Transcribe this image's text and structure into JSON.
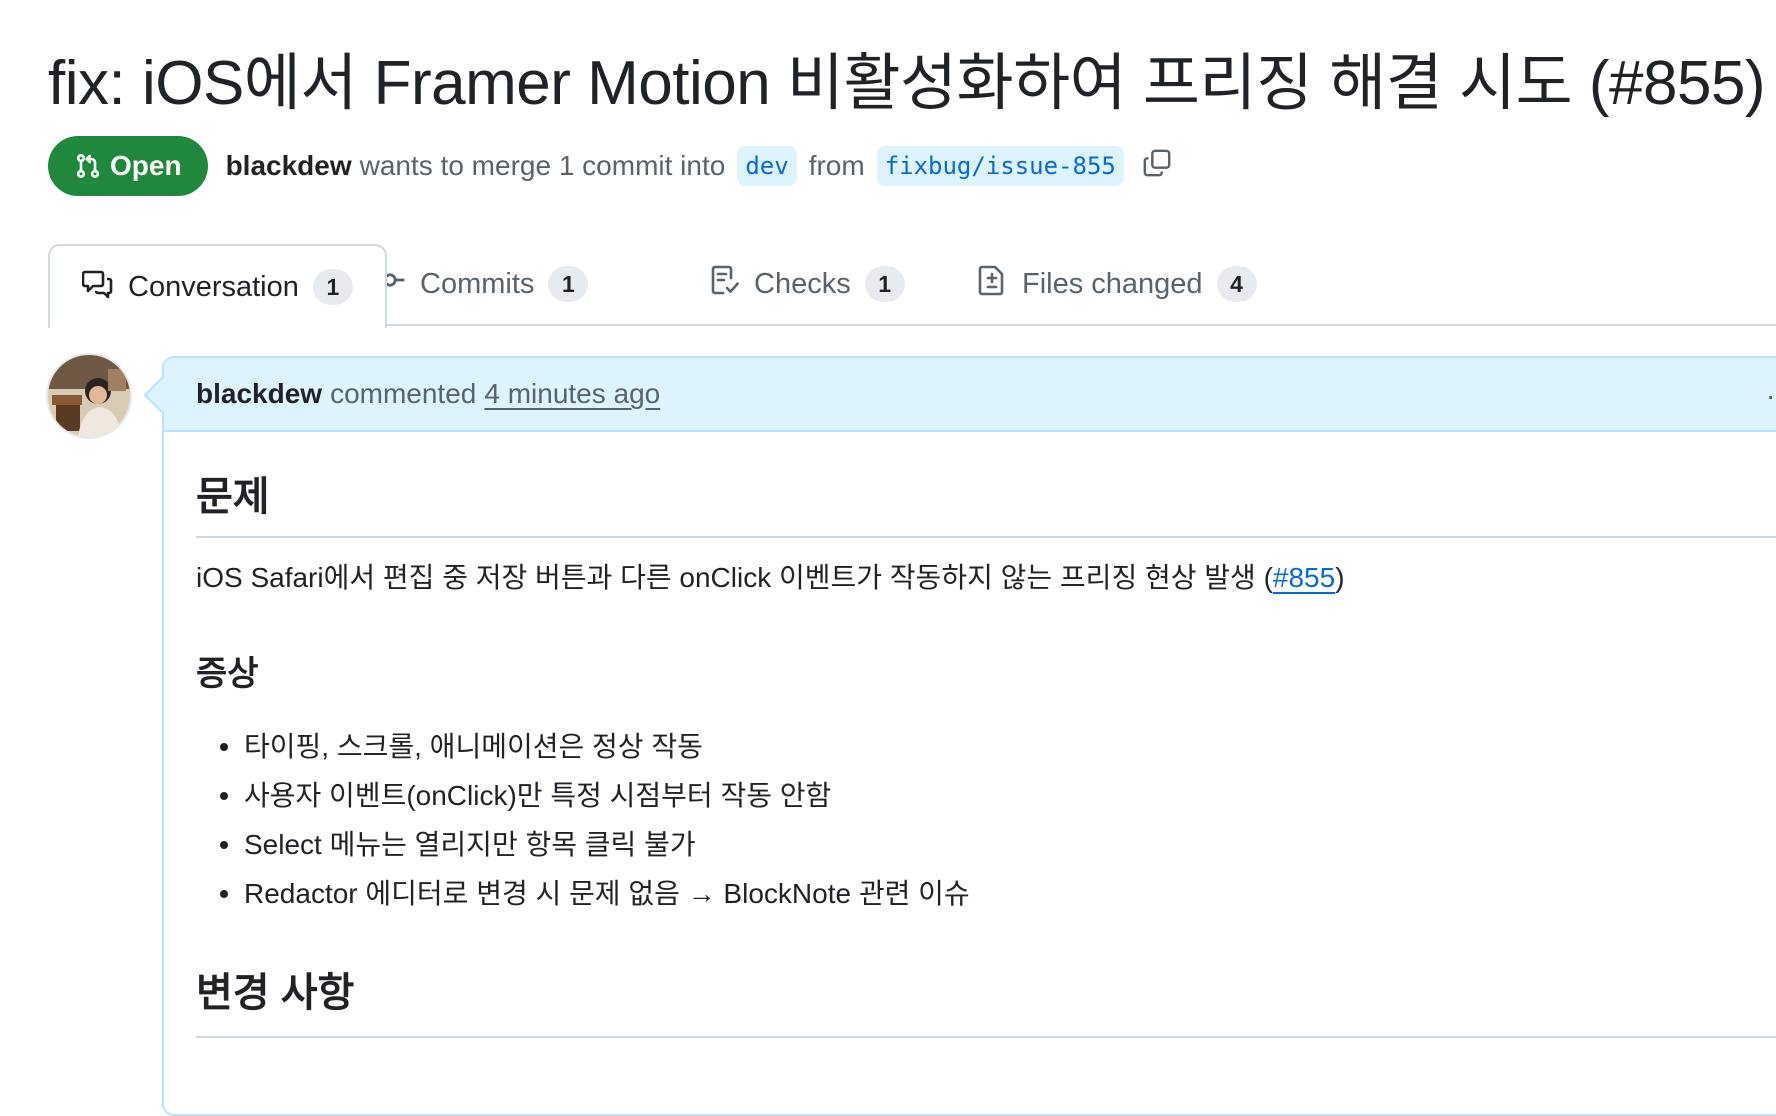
{
  "pr": {
    "title": "fix: iOS에서 Framer Motion 비활성화하여 프리징 해결 시도 (#855)",
    "title_overflow": "#",
    "state": "Open",
    "author": "blackdew",
    "merge_text": "wants to merge 1 commit into",
    "base_branch": "dev",
    "from_text": "from",
    "head_branch": "fixbug/issue-855"
  },
  "tabs": [
    {
      "label": "Conversation",
      "count": "1",
      "icon": "comment-discussion-icon"
    },
    {
      "label": "Commits",
      "count": "1",
      "icon": "git-commit-icon"
    },
    {
      "label": "Checks",
      "count": "1",
      "icon": "checklist-icon"
    },
    {
      "label": "Files changed",
      "count": "4",
      "icon": "file-diff-icon"
    }
  ],
  "comment": {
    "author": "blackdew",
    "action": "commented",
    "time": "4 minutes ago",
    "body": {
      "heading1": "문제",
      "intro_before_link": "iOS Safari에서 편집 중 저장 버튼과 다른 onClick 이벤트가 작동하지 않는 프리징 현상 발생 (",
      "intro_link": "#855",
      "intro_after_link": ")",
      "heading2": "증상",
      "symptoms": [
        "타이핑, 스크롤, 애니메이션은 정상 작동",
        "사용자 이벤트(onClick)만 특정 시점부터 작동 안함",
        "Select 메뉴는 열리지만 항목 클릭 불가",
        "Redactor 에디터로 변경 시 문제 없음 → BlockNote 관련 이슈"
      ],
      "heading3": "변경 사항"
    }
  },
  "colors": {
    "open_green": "#1f883d",
    "link_blue": "#0969da",
    "branch_bg": "#ddf4ff",
    "comment_header_bg": "#ddf4ff",
    "comment_border": "#b6e3ff",
    "muted_text": "#59636e"
  }
}
